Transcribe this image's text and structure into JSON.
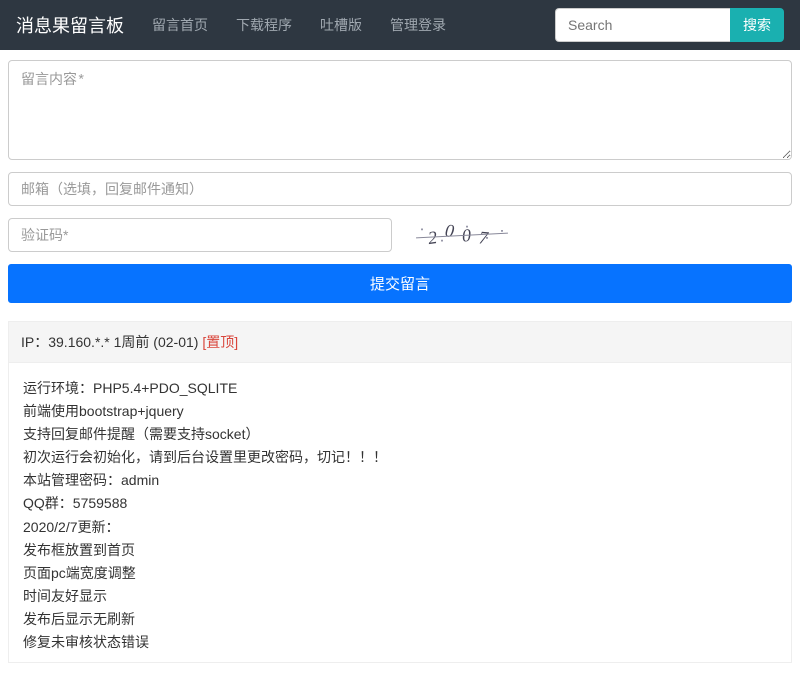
{
  "navbar": {
    "brand": "消息果留言板",
    "links": [
      "留言首页",
      "下载程序",
      "吐槽版",
      "管理登录"
    ],
    "search_placeholder": "Search",
    "search_button": "搜索"
  },
  "form": {
    "content_placeholder": "留言内容*",
    "email_placeholder": "邮箱（选填，回复邮件通知）",
    "captcha_placeholder": "验证码*",
    "captcha_value": "2007",
    "submit_label": "提交留言"
  },
  "post": {
    "meta_prefix": "IP：",
    "ip": "39.160.*.*",
    "time": "1周前 (02-01)",
    "pin_label": "[置顶]",
    "body_lines": [
      "运行环境：PHP5.4+PDO_SQLITE",
      "前端使用bootstrap+jquery",
      "支持回复邮件提醒（需要支持socket）",
      "初次运行会初始化，请到后台设置里更改密码，切记！！！",
      "本站管理密码：admin",
      "QQ群：5759588",
      "2020/2/7更新：",
      "发布框放置到首页",
      "页面pc端宽度调整",
      "时间友好显示",
      "发布后显示无刷新",
      "修复未审核状态错误"
    ]
  }
}
